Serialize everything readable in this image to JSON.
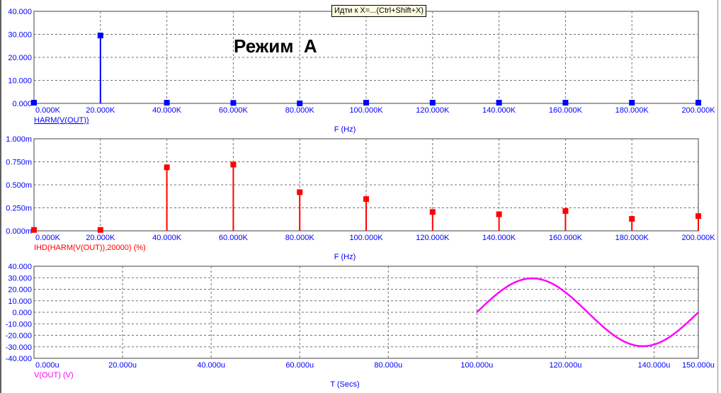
{
  "tooltip": "Идти к X=...(Ctrl+Shift+X)",
  "annotation": "Режим  A",
  "chart_data": [
    {
      "type": "bar",
      "style": "stem",
      "trace_label": "HARM(V(OUT))",
      "xlabel": "F (Hz)",
      "color": "#0000ff",
      "x": [
        0,
        20000,
        40000,
        60000,
        80000,
        100000,
        120000,
        140000,
        160000,
        180000,
        200000
      ],
      "values": [
        0.3,
        29.5,
        0.3,
        0.2,
        0.0,
        0.3,
        0.3,
        0.3,
        0.3,
        0.3,
        0.3
      ],
      "xlim": [
        0,
        200000
      ],
      "ylim": [
        0,
        40
      ],
      "xticks": [
        "0.000K",
        "20.000K",
        "40.000K",
        "60.000K",
        "80.000K",
        "100.000K",
        "120.000K",
        "140.000K",
        "160.000K",
        "180.000K",
        "200.000K"
      ],
      "yticks": [
        "0.000",
        "10.000",
        "20.000",
        "30.000",
        "40.000"
      ],
      "grid": true
    },
    {
      "type": "bar",
      "style": "stem",
      "trace_label": "IHD(HARM(V(OUT)),20000) (%)",
      "xlabel": "F (Hz)",
      "color": "#ff0000",
      "x": [
        0,
        20000,
        40000,
        60000,
        80000,
        100000,
        120000,
        140000,
        160000,
        180000,
        200000
      ],
      "values": [
        0.01,
        0.01,
        0.69,
        0.72,
        0.42,
        0.345,
        0.205,
        0.18,
        0.215,
        0.13,
        0.16
      ],
      "xlim": [
        0,
        200000
      ],
      "ylim": [
        0,
        1.0
      ],
      "xticks": [
        "0.000K",
        "20.000K",
        "40.000K",
        "60.000K",
        "80.000K",
        "100.000K",
        "120.000K",
        "140.000K",
        "160.000K",
        "180.000K",
        "200.000K"
      ],
      "yticks": [
        "0.000m",
        "0.250m",
        "0.500m",
        "0.750m",
        "1.000m"
      ],
      "grid": true
    },
    {
      "type": "line",
      "trace_label": "V(OUT) (V)",
      "xlabel": "T (Secs)",
      "color": "#ff00ff",
      "signal": {
        "shape": "sine",
        "amplitude": 29.5,
        "period_us": 50,
        "start_us": 100,
        "end_us": 150
      },
      "xlim": [
        0,
        150
      ],
      "ylim": [
        -40,
        40
      ],
      "xticks": [
        "0.000u",
        "20.000u",
        "40.000u",
        "60.000u",
        "80.000u",
        "100.000u",
        "120.000u",
        "140.000u",
        "150.000u"
      ],
      "xtick_values": [
        0,
        20,
        40,
        60,
        80,
        100,
        120,
        140,
        150
      ],
      "yticks": [
        "-40.000",
        "-30.000",
        "-20.000",
        "-10.000",
        "0.000",
        "10.000",
        "20.000",
        "30.000",
        "40.000"
      ],
      "grid": true
    }
  ]
}
